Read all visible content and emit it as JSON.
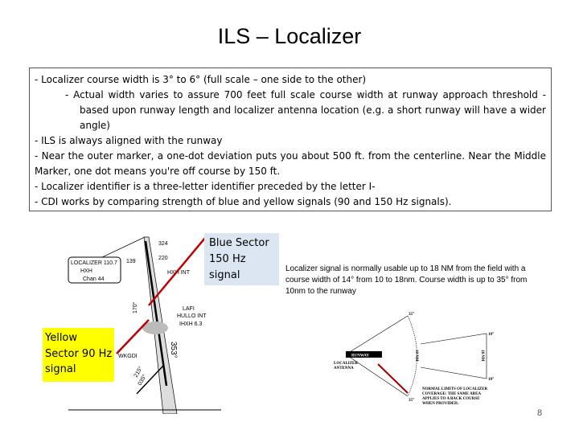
{
  "slide": {
    "title": "ILS – Localizer",
    "bullets": [
      "-   Localizer course width is 3° to 6° (full scale – one side to the other)",
      "-   Actual width varies to assure 700 feet full scale course width at runway approach threshold - based upon runway length and localizer antenna location (e.g. a short runway will have a wider angle)",
      "- ILS is always aligned with the runway",
      "- Near the outer marker, a one-dot deviation puts you about 500 ft. from the centerline.  Near the Middle Marker, one dot means you're off course by 150 ft.",
      "- Localizer identifier is a three-letter identifier preceded by the letter I-",
      "- CDI works by comparing strength of blue and yellow signals (90 and 150 Hz signals)."
    ],
    "blue_callout": [
      "Blue Sector",
      "150 Hz",
      "signal"
    ],
    "yellow_callout": [
      "Yellow",
      "Sector 90 Hz",
      "signal"
    ],
    "coverage_note": "Localizer signal is normally usable up to 18 NM from the field with a course width of 14° from 10 to 18nm.  Course width is up to 35° from 10nm to the runway",
    "page_number": "8"
  },
  "approach_chart": {
    "localizer_box": [
      "LOCALIZER 110.7",
      "HXH",
      "Chan 44"
    ],
    "labels": [
      "324",
      "220",
      "139",
      "HXH INT",
      "LAFI",
      "HULLO INT",
      "IHXH 6.3",
      "WKGDI",
      "215°",
      "035°",
      "170°",
      "353°"
    ]
  },
  "coverage_diagram": {
    "runway_label": "RUNWAY",
    "antenna_label": [
      "LOCALIZER",
      "ANTENNA"
    ],
    "angles": [
      "35°",
      "35°",
      "10°",
      "10°"
    ],
    "distances": [
      "10 NM",
      "18 NM"
    ],
    "caption": [
      "NORMAL LIMITS OF LOCALIZER",
      "COVERAGE: THE SAME AREA",
      "APPLIES TO A BACK COURSE",
      "WHEN PROVIDED."
    ]
  },
  "colors": {
    "blue_callout": "#dce6f2",
    "yellow_callout": "#ffff00",
    "arrow": "#c00000"
  }
}
